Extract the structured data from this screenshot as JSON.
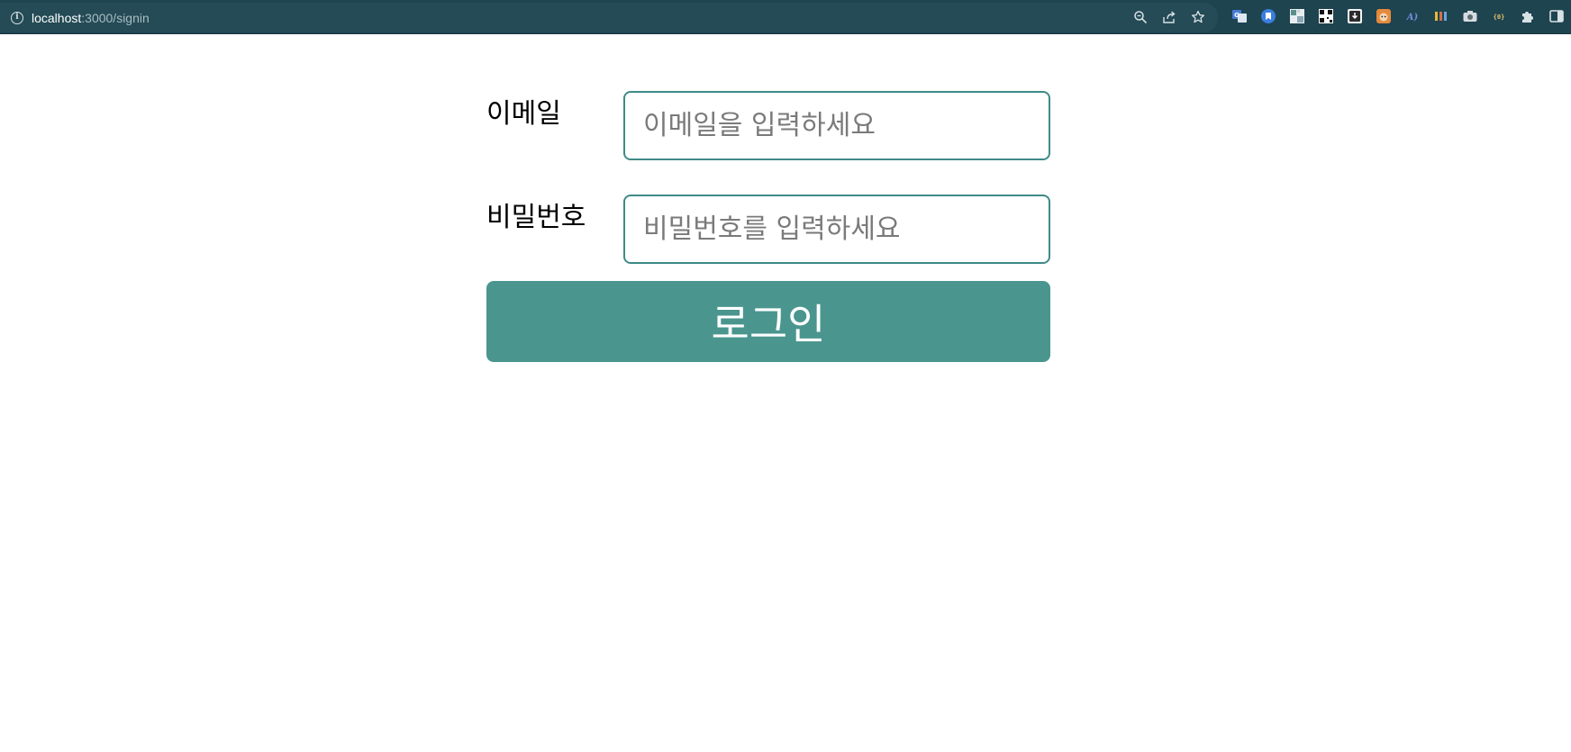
{
  "browser": {
    "url_host": "localhost",
    "url_path": ":3000/signin",
    "colors": {
      "chrome_bg": "#1e4450",
      "omnibox_bg": "#244b56"
    },
    "omnibox_actions": [
      {
        "name": "zoom-icon"
      },
      {
        "name": "share-icon"
      },
      {
        "name": "bookmark-star-icon"
      }
    ],
    "extensions": [
      {
        "name": "translate-extension-icon"
      },
      {
        "name": "bookmark-extension-icon"
      },
      {
        "name": "image-extension-icon"
      },
      {
        "name": "qr-extension-icon"
      },
      {
        "name": "download-extension-icon"
      },
      {
        "name": "fox-extension-icon"
      },
      {
        "name": "script-extension-icon"
      },
      {
        "name": "bars-extension-icon"
      },
      {
        "name": "camera-extension-icon"
      },
      {
        "name": "code-extension-icon"
      },
      {
        "name": "puzzle-icon"
      },
      {
        "name": "side-panel-icon"
      }
    ]
  },
  "signin": {
    "email_label": "이메일",
    "email_placeholder": "이메일을 입력하세요",
    "password_label": "비밀번호",
    "password_placeholder": "비밀번호를 입력하세요",
    "login_label": "로그인",
    "colors": {
      "accent": "#4a968f",
      "input_border": "#3f8a87"
    }
  }
}
